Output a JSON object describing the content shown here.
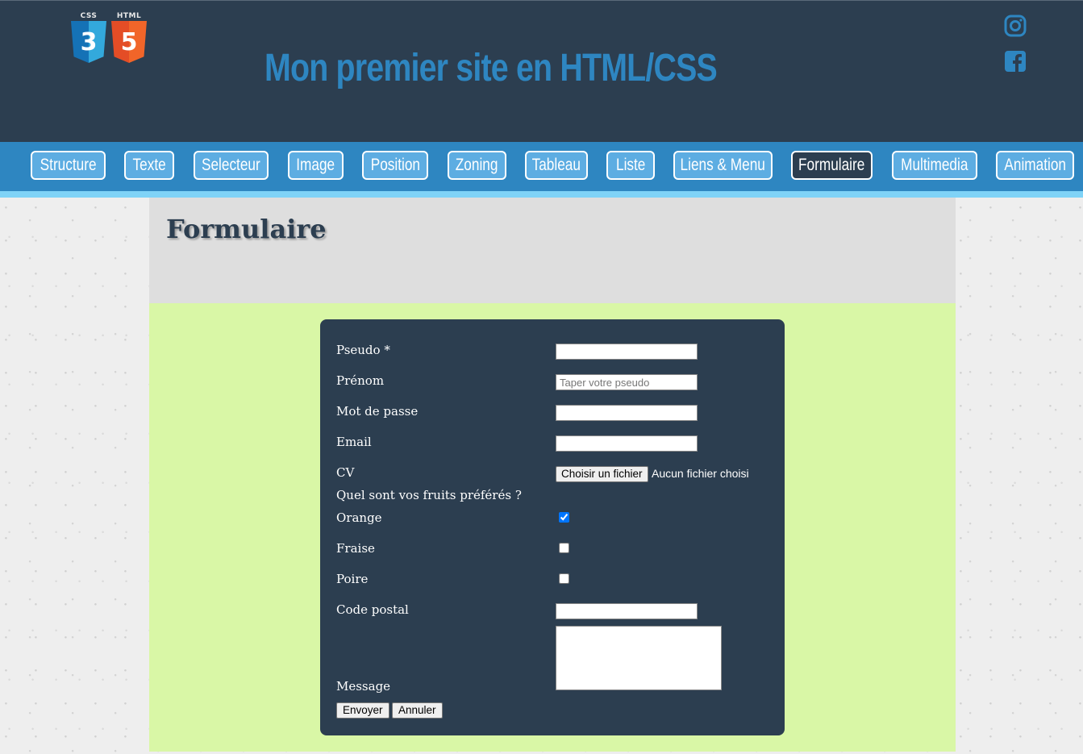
{
  "header": {
    "logos": [
      {
        "caption": "CSS",
        "glyph": "3",
        "icon": "css3-logo-icon"
      },
      {
        "caption": "HTML",
        "glyph": "5",
        "icon": "html5-logo-icon"
      }
    ],
    "title": "Mon premier site en HTML/CSS",
    "social": [
      "instagram-icon",
      "facebook-icon"
    ],
    "colors": {
      "background": "#2c3e50",
      "title": "#2e86c1"
    }
  },
  "nav": {
    "items": [
      {
        "label": "Structure",
        "active": false
      },
      {
        "label": "Texte",
        "active": false
      },
      {
        "label": "Selecteur",
        "active": false
      },
      {
        "label": "Image",
        "active": false
      },
      {
        "label": "Position",
        "active": false
      },
      {
        "label": "Zoning",
        "active": false
      },
      {
        "label": "Tableau",
        "active": false
      },
      {
        "label": "Liste",
        "active": false
      },
      {
        "label": "Liens & Menu",
        "active": false
      },
      {
        "label": "Formulaire",
        "active": true
      },
      {
        "label": "Multimedia",
        "active": false
      },
      {
        "label": "Animation",
        "active": false
      }
    ],
    "colors": {
      "bar": "#2e86c1",
      "item": "#5dade2",
      "active": "#2c3e50",
      "underline": "#7fd3f7"
    }
  },
  "page": {
    "heading": "Formulaire"
  },
  "form": {
    "pseudo_label": "Pseudo *",
    "pseudo_value": "",
    "prenom_label": "Prénom",
    "prenom_placeholder": "Taper votre pseudo",
    "password_label": "Mot de passe",
    "email_label": "Email",
    "cv_label": "CV",
    "cv_button": "Choisir un fichier",
    "cv_status": "Aucun fichier choisi",
    "fruits_question": "Quel sont vos fruits préférés ?",
    "fruits": [
      {
        "label": "Orange",
        "checked": true
      },
      {
        "label": "Fraise",
        "checked": false
      },
      {
        "label": "Poire",
        "checked": false
      }
    ],
    "postal_label": "Code postal",
    "message_label": "Message",
    "submit_label": "Envoyer",
    "reset_label": "Annuler",
    "colors": {
      "box": "#2c3e50",
      "zone": "#d9f7a6"
    }
  }
}
